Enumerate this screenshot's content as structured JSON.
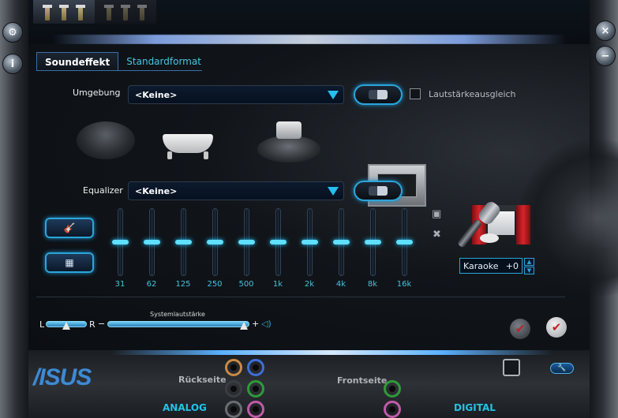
{
  "tabs": [
    {
      "label": "Soundeffekt",
      "active": true
    },
    {
      "label": "Standardformat",
      "active": false
    }
  ],
  "environment": {
    "label": "Umgebung",
    "selected": "<Keine>",
    "loudness_equalization_label": "Lautstärkeausgleich",
    "loudness_equalization_checked": false,
    "presets": [
      {
        "icon": "padded-cell-icon"
      },
      {
        "icon": "bathtub-icon"
      },
      {
        "icon": "stage-icon"
      },
      {
        "icon": "room-icon"
      },
      {
        "icon": "theater-icon"
      }
    ]
  },
  "equalizer": {
    "label": "Equalizer",
    "selected": "<Keine>",
    "bands": [
      {
        "freq": "31",
        "level": 0.5
      },
      {
        "freq": "62",
        "level": 0.5
      },
      {
        "freq": "125",
        "level": 0.5
      },
      {
        "freq": "250",
        "level": 0.5
      },
      {
        "freq": "500",
        "level": 0.5
      },
      {
        "freq": "1k",
        "level": 0.5
      },
      {
        "freq": "2k",
        "level": 0.5
      },
      {
        "freq": "4k",
        "level": 0.5
      },
      {
        "freq": "8k",
        "level": 0.5
      },
      {
        "freq": "16k",
        "level": 0.5
      }
    ]
  },
  "karaoke": {
    "label": "Karaoke",
    "value": "+0"
  },
  "volume": {
    "left_label": "L",
    "right_label": "R",
    "minus": "−",
    "plus": "+",
    "system_caption": "Systemlautstärke",
    "balance_level": 0.5,
    "system_level": 0.96
  },
  "bottom": {
    "logo": "/ISUS",
    "rear_label": "Rückseite",
    "front_label": "Frontseite",
    "analog_label": "ANALOG",
    "digital_label": "DIGITAL"
  },
  "colors": {
    "accent": "#2aa6d9",
    "freq_text": "#47c3e0",
    "tab_inactive": "#45c6e6",
    "logo": "#3d8ad6"
  }
}
